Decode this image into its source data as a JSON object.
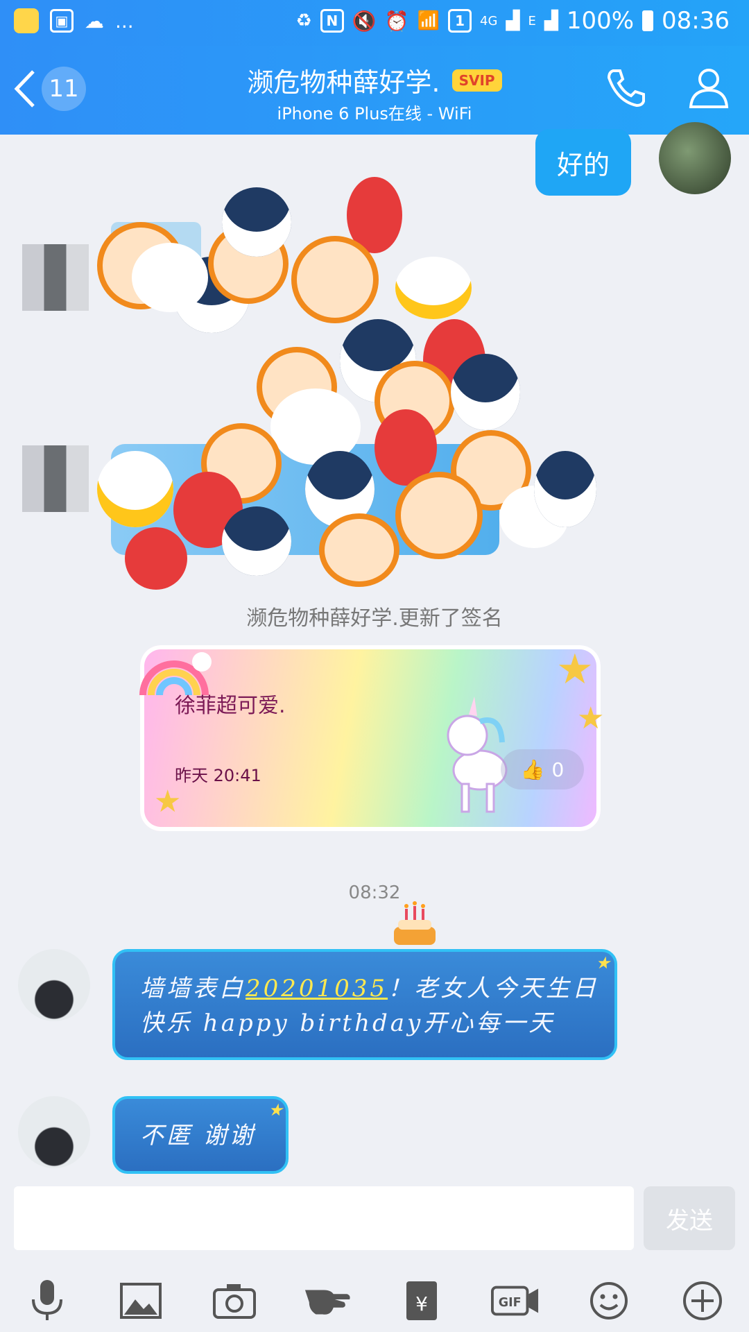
{
  "status_bar": {
    "dots": "...",
    "sim_slot": "1",
    "network_4g": "4G",
    "network_e": "E",
    "battery": "100%",
    "time": "08:36"
  },
  "header": {
    "unread_count": "11",
    "title": "濒危物种薛好学.",
    "vip_badge": "SVIP",
    "subtitle": "iPhone 6 Plus在线 - WiFi"
  },
  "messages": {
    "my_reply": "好的",
    "signature_notice": "濒危物种薛好学.更新了签名",
    "signature_card": {
      "text": "徐菲超可爱.",
      "time": "昨天 20:41",
      "likes": "0"
    },
    "timestamp": "08:32",
    "msg1_part1": "墙墙表白",
    "msg1_link": "20201035",
    "msg1_part2": "！老女人今天生日快乐 happy birthday开心每一天",
    "msg2": "不匿 谢谢"
  },
  "composer": {
    "send_label": "发送"
  },
  "colors": {
    "header_blue": "#2f8ff7",
    "my_bubble": "#1fa6f5",
    "their_bubble": "#2b6fc1"
  }
}
